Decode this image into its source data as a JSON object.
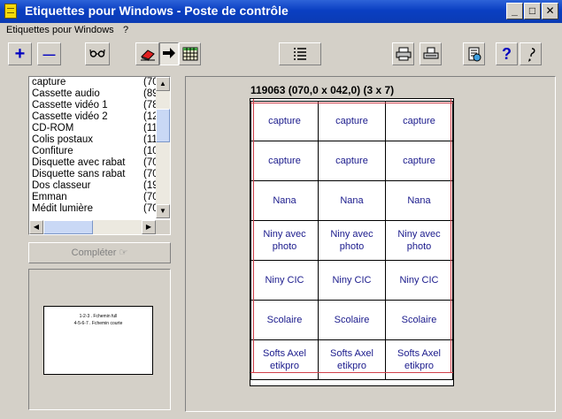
{
  "window": {
    "title": "Etiquettes pour Windows - Poste de contrôle",
    "minimize": "_",
    "maximize": "□",
    "close": "✕"
  },
  "menu": {
    "items": [
      "Etiquettes pour Windows",
      "?"
    ]
  },
  "toolbar": {
    "add_label": "+",
    "remove_label": "—",
    "help_label": "?",
    "icons": [
      "plus-icon",
      "minus-icon",
      "glasses-icon",
      "eraser-icon",
      "arrow-right-icon",
      "grid-icon",
      "list-icon",
      "printer-setup-icon",
      "printer-icon",
      "document-icon",
      "help-icon",
      "context-help-icon"
    ],
    "accent": "#0000c0"
  },
  "list": {
    "items": [
      {
        "name": "capture",
        "count": "(70"
      },
      {
        "name": "Cassette audio",
        "count": "(89"
      },
      {
        "name": "Cassette vidéo 1",
        "count": "(78"
      },
      {
        "name": "Cassette vidéo 2",
        "count": "(12"
      },
      {
        "name": "CD-ROM",
        "count": "(11"
      },
      {
        "name": "Colis postaux",
        "count": "(11"
      },
      {
        "name": "Confiture",
        "count": "(10"
      },
      {
        "name": "Disquette avec rabat",
        "count": "(70"
      },
      {
        "name": "Disquette sans rabat",
        "count": "(70"
      },
      {
        "name": "Dos classeur",
        "count": "(19"
      },
      {
        "name": "Emman",
        "count": "(70"
      },
      {
        "name": "Médit lumière",
        "count": "(70"
      }
    ]
  },
  "completer_label": "Compléter ☞",
  "preview": {
    "lines": [
      "1-2-3 . Fchemin full",
      "4-5-6-7 . Fchemin courte"
    ]
  },
  "sheet": {
    "title": "119063 (070,0 x 042,0) (3 x 7)",
    "rows": 7,
    "cols": 3,
    "cells": [
      [
        "capture",
        "capture",
        "capture"
      ],
      [
        "capture",
        "capture",
        "capture"
      ],
      [
        "Nana",
        "Nana",
        "Nana"
      ],
      [
        "Niny avec photo",
        "Niny avec photo",
        "Niny avec photo"
      ],
      [
        "Niny CIC",
        "Niny CIC",
        "Niny CIC"
      ],
      [
        "Scolaire",
        "Scolaire",
        "Scolaire"
      ],
      [
        "Softs Axel etikpro",
        "Softs Axel etikpro",
        "Softs Axel etikpro"
      ]
    ],
    "text_color": "#1a1a8c",
    "margin_color": "#d0404a"
  }
}
